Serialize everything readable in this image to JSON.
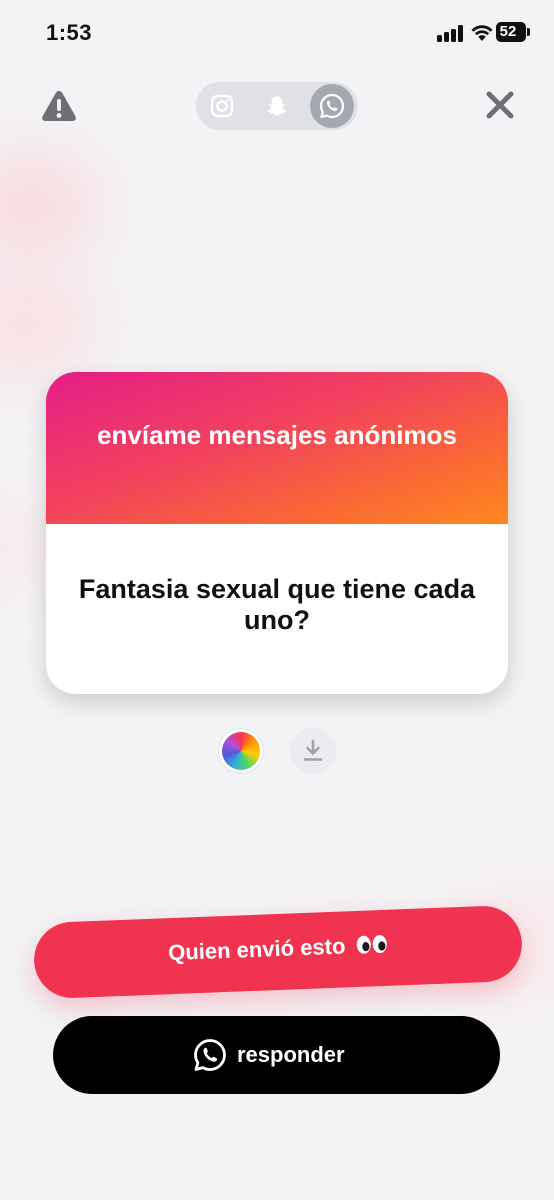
{
  "status_bar": {
    "time": "1:53",
    "battery_level": "52"
  },
  "toolbar": {
    "warning_icon": "warning-icon",
    "close_icon": "close-icon",
    "share_options": [
      "instagram-icon",
      "snapchat-icon",
      "whatsapp-icon"
    ],
    "selected_share": "whatsapp"
  },
  "card": {
    "header": "envíame mensajes anónimos",
    "question": "Fantasia sexual que tiene cada uno?",
    "gradient_colors": [
      "#e51d88",
      "#f2445a",
      "#fd8820"
    ]
  },
  "controls": {
    "color_picker_icon": "color-wheel-icon",
    "download_icon": "download-icon"
  },
  "actions": {
    "who_sent_label": "Quien envió esto",
    "who_sent_emoji": "eyes-icon",
    "reply_label": "responder",
    "reply_icon": "whatsapp-icon"
  },
  "colors": {
    "accent": "#f0334f",
    "reply_bg": "#000000",
    "background": "#f3f3f5"
  }
}
